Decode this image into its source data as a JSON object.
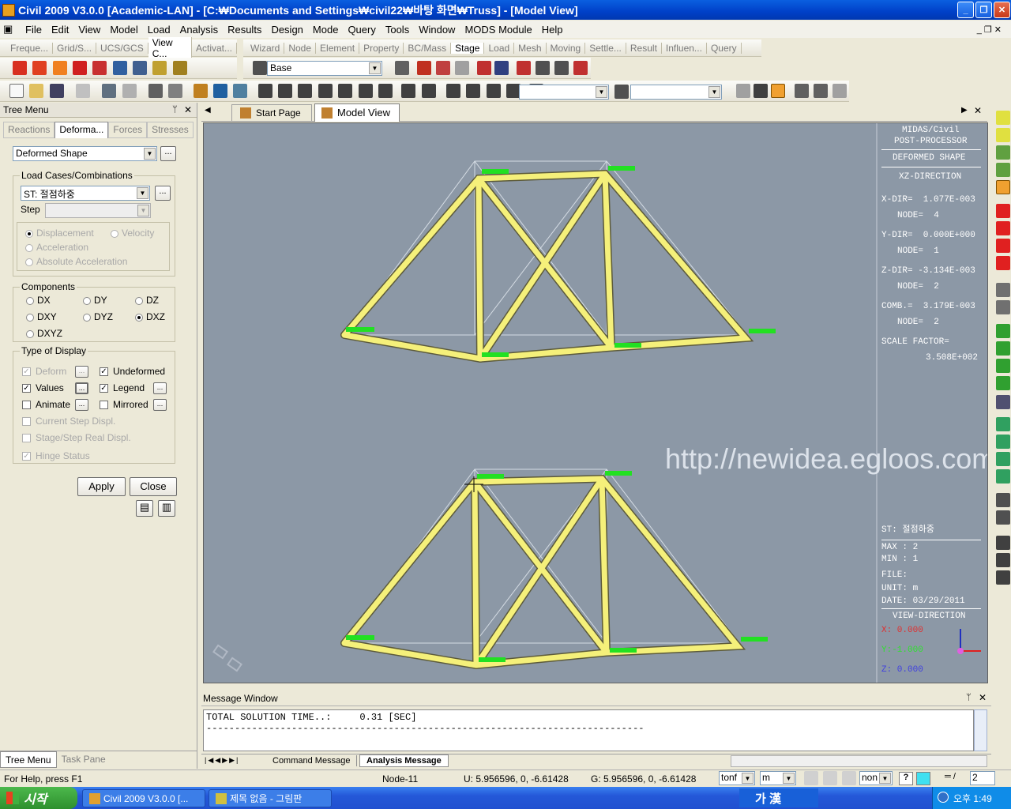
{
  "window": {
    "title": "Civil 2009 V3.0.0 [Academic-LAN] - [C:₩Documents and Settings₩civil22₩바탕 화면₩Truss] - [Model View]"
  },
  "menu": [
    "File",
    "Edit",
    "View",
    "Model",
    "Load",
    "Analysis",
    "Results",
    "Design",
    "Mode",
    "Query",
    "Tools",
    "Window",
    "MODS Module",
    "Help"
  ],
  "tabs_left": [
    "Freque...",
    "Grid/S...",
    "UCS/GCS",
    "View C...",
    "Activat..."
  ],
  "tabs_right": [
    "Wizard",
    "Node",
    "Element",
    "Property",
    "BC/Mass",
    "Stage",
    "Load",
    "Mesh",
    "Moving",
    "Settle...",
    "Result",
    "Influen...",
    "Query"
  ],
  "toolbar": {
    "base_label": "Base"
  },
  "tree": {
    "title": "Tree Menu",
    "tabs": [
      "Reactions",
      "Deforma...",
      "Forces",
      "Stresses"
    ],
    "shape_select": "Deformed Shape",
    "load_group": "Load Cases/Combinations",
    "load_value": "ST: 절점하중",
    "step_label": "Step",
    "disp_options": [
      "Displacement",
      "Velocity",
      "Acceleration",
      "Absolute Acceleration"
    ],
    "components_title": "Components",
    "components": [
      "DX",
      "DY",
      "DZ",
      "DXY",
      "DYZ",
      "DXZ",
      "DXYZ"
    ],
    "display_title": "Type of Display",
    "display": {
      "deform": "Deform",
      "undeformed": "Undeformed",
      "values": "Values",
      "legend": "Legend",
      "animate": "Animate",
      "mirrored": "Mirrored",
      "current": "Current Step Displ.",
      "stage": "Stage/Step Real Displ.",
      "hinge": "Hinge Status"
    },
    "apply": "Apply",
    "close": "Close",
    "bottom_tabs": [
      "Tree Menu",
      "Task Pane"
    ],
    "more": "..."
  },
  "doc_tabs": [
    "Start Page",
    "Model View"
  ],
  "info": {
    "l1": "MIDAS/Civil",
    "l2": "POST-PROCESSOR",
    "l3": "DEFORMED SHAPE",
    "l4": "XZ-DIRECTION",
    "x": "X-DIR=  1.077E-003",
    "xn": "NODE=  4",
    "y": "Y-DIR=  0.000E+000",
    "yn": "NODE=  1",
    "z": "Z-DIR= -3.134E-003",
    "zn": "NODE=  2",
    "c": "COMB.=  3.179E-003",
    "cn": "NODE=  2",
    "sf": "SCALE FACTOR=",
    "sfv": "3.508E+002",
    "st": "ST: 절점하중",
    "max": "MAX : 2",
    "min": "MIN : 1",
    "file": "FILE:",
    "unit": "UNIT: m",
    "date": "DATE: 03/29/2011",
    "vd": "VIEW-DIRECTION",
    "vx": "X: 0.000",
    "vy": "Y:-1.000",
    "vz": "Z: 0.000"
  },
  "watermark": "http://newidea.egloos.com/",
  "message": {
    "title": "Message Window",
    "line1": "TOTAL SOLUTION TIME..:     0.31 [SEC]",
    "line2": "-----------------------------------------------------------------------------",
    "tabs": [
      "Command Message",
      "Analysis Message"
    ]
  },
  "status": {
    "help": "For Help, press F1",
    "node": "Node-11",
    "u": "U: 5.956596, 0, -6.61428",
    "g": "G: 5.956596, 0, -6.61428",
    "force": "tonf",
    "len": "m",
    "mode": "non",
    "page": "2"
  },
  "taskbar": {
    "start": "시작",
    "t1": "Civil 2009 V3.0.0 [...",
    "t2": "제목 없음 - 그림판",
    "ime": "가 漢",
    "time": "오후 1:49"
  },
  "colors": {
    "truss": "#F5F07A",
    "label": "#22E022"
  }
}
